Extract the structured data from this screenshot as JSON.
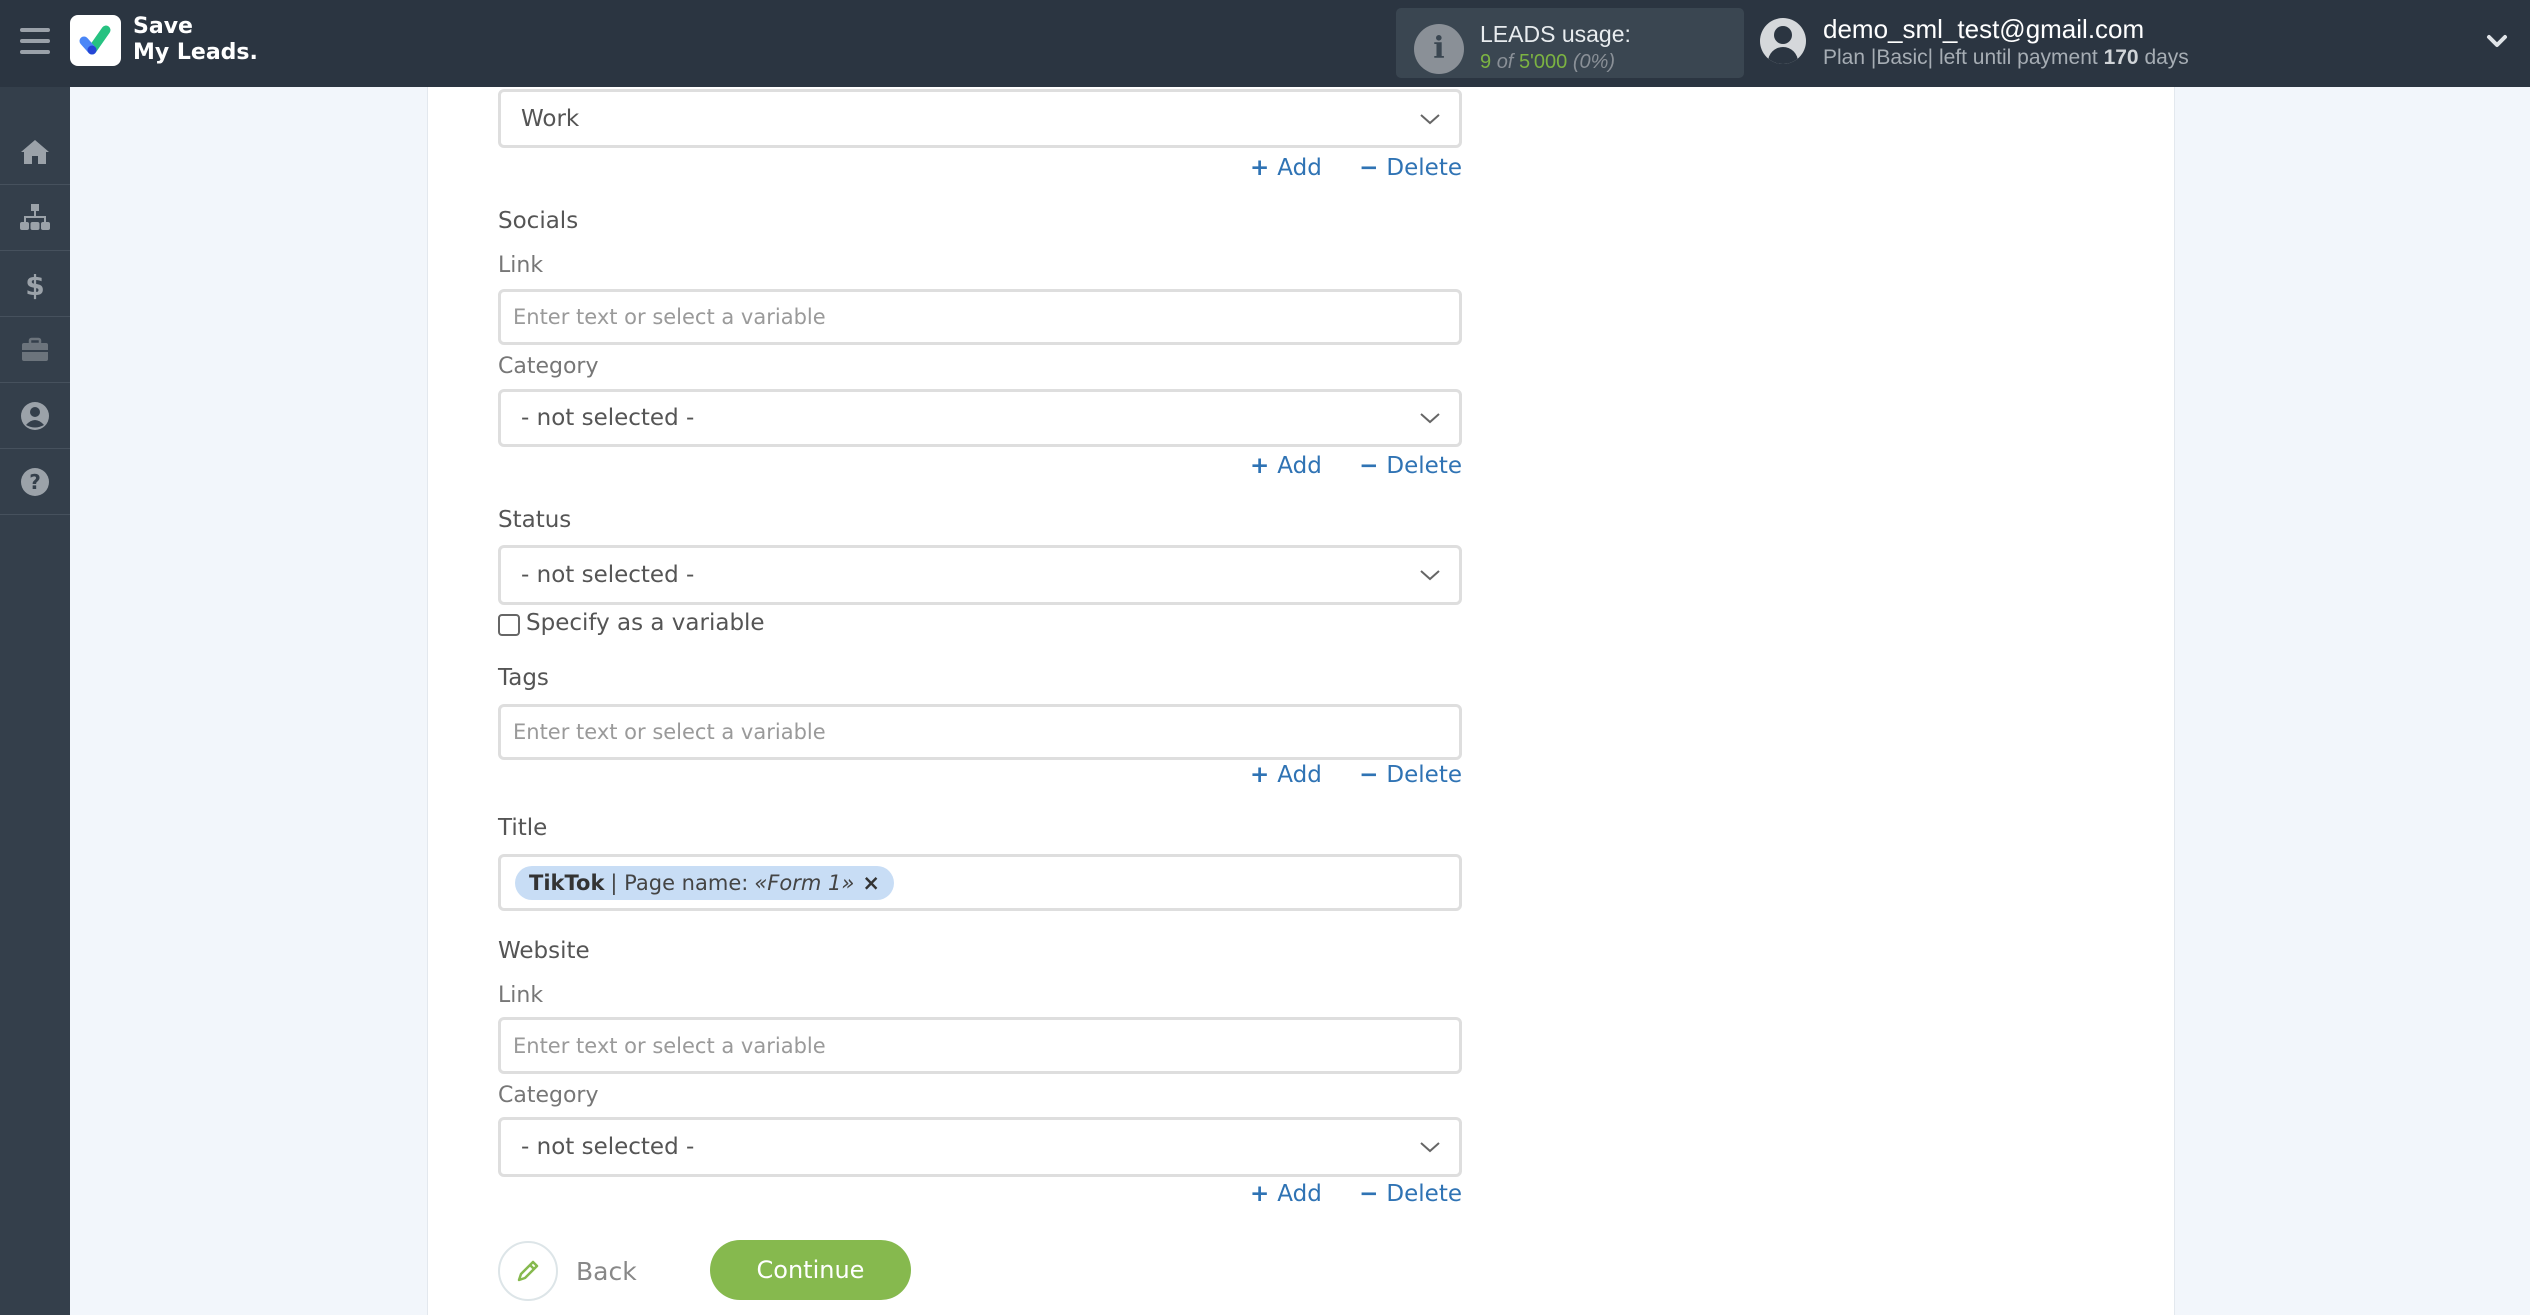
{
  "header": {
    "logo_line1": "Save",
    "logo_line2": "My Leads.",
    "usage_title": "LEADS usage:",
    "usage_used": "9",
    "usage_of": "of",
    "usage_total": "5'000",
    "usage_percent": "(0%)",
    "user_email": "demo_sml_test@gmail.com",
    "plan_prefix": "Plan |Basic| left until payment",
    "plan_days": "170",
    "plan_suffix": "days"
  },
  "sidebar": {
    "items": [
      {
        "name": "home",
        "icon": "home-icon"
      },
      {
        "name": "connections",
        "icon": "sitemap-icon"
      },
      {
        "name": "billing",
        "icon": "dollar-icon"
      },
      {
        "name": "tools",
        "icon": "briefcase-icon"
      },
      {
        "name": "account",
        "icon": "user-circle-icon"
      },
      {
        "name": "help",
        "icon": "question-circle-icon"
      }
    ]
  },
  "form": {
    "add_label": "Add",
    "delete_label": "Delete",
    "placeholder": "Enter text or select a variable",
    "phone_category_value": "Work",
    "socials": {
      "title": "Socials",
      "link_label": "Link",
      "category_label": "Category",
      "category_value": "- not selected -"
    },
    "status": {
      "title": "Status",
      "value": "- not selected -",
      "checkbox_label": "Specify as a variable",
      "checked": false
    },
    "tags": {
      "title": "Tags"
    },
    "title_field": {
      "title": "Title",
      "chip_source": "TikTok",
      "chip_sep": "| Page name:",
      "chip_value": "«Form 1»",
      "chip_remove": "×"
    },
    "website": {
      "title": "Website",
      "link_label": "Link",
      "category_label": "Category",
      "category_value": "- not selected -"
    },
    "back_label": "Back",
    "continue_label": "Continue"
  }
}
